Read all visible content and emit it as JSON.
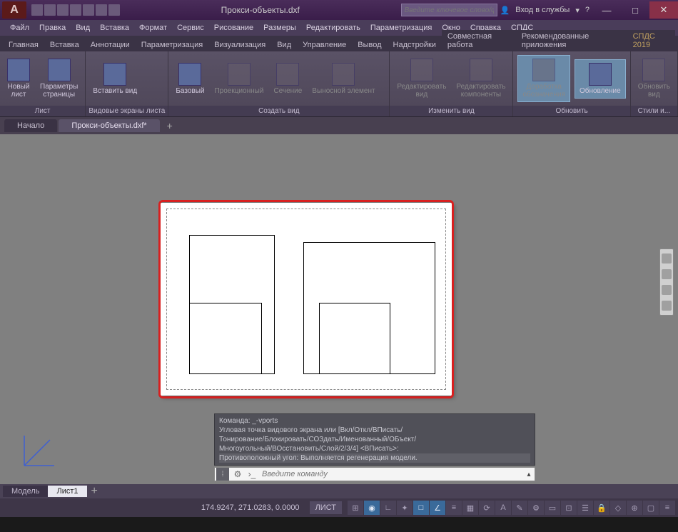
{
  "app": {
    "logo_letter": "A",
    "title": "Прокси-объекты.dxf",
    "search_placeholder": "Введите ключевое слово/фразу",
    "signin": "Вход в службы"
  },
  "window_controls": {
    "min": "—",
    "max": "□",
    "close": "✕"
  },
  "menubar": [
    "Файл",
    "Правка",
    "Вид",
    "Вставка",
    "Формат",
    "Сервис",
    "Рисование",
    "Размеры",
    "Редактировать",
    "Параметризация",
    "Окно",
    "Справка",
    "СПДС"
  ],
  "ribbon_tabs": [
    "Главная",
    "Вставка",
    "Аннотации",
    "Параметризация",
    "Визуализация",
    "Вид",
    "Управление",
    "Вывод",
    "Надстройки",
    "Совместная работа",
    "Рекомендованные приложения"
  ],
  "ribbon_extra": "СПДС 2019",
  "panels": {
    "sheet": {
      "label": "Лист",
      "buttons": [
        {
          "label": "Новый\nлист"
        },
        {
          "label": "Параметры\nстраницы"
        }
      ]
    },
    "viewports": {
      "label": "Видовые экраны листа",
      "button": {
        "label": "Вставить вид"
      }
    },
    "create": {
      "label": "Создать вид",
      "buttons": [
        {
          "label": "Базовый"
        },
        {
          "label": "Проекционный"
        },
        {
          "label": "Сечение"
        },
        {
          "label": "Выносной элемент"
        }
      ]
    },
    "edit": {
      "label": "Изменить вид",
      "buttons": [
        {
          "label": "Редактировать\nвид"
        },
        {
          "label": "Редактировать\nкомпоненты"
        }
      ]
    },
    "finalize": {
      "buttons": [
        {
          "label": "Доработка\nобозначения"
        },
        {
          "label": "Обновление"
        }
      ]
    },
    "update": {
      "label": "Обновить",
      "button": {
        "label": "Обновить\nвид"
      }
    },
    "styles": {
      "label": "Стили и..."
    }
  },
  "file_tabs": {
    "start": "Начало",
    "active": "Прокси-объекты.dxf*"
  },
  "command_history": [
    "Команда: _-vports",
    "Угловая точка видового экрана или [Вкл/Откл/ВПисать/",
    "Тонирование/Блокировать/СОЗдать/Именованный/ОБъект/",
    "Многоугольный/ВОсстановить/Слой/2/3/4] <ВПисать>:",
    "Противоположный угол: Выполняется регенерация модели."
  ],
  "command_line": {
    "placeholder": "Введите команду"
  },
  "layout_tabs": {
    "model": "Модель",
    "sheet1": "Лист1"
  },
  "statusbar": {
    "coords": "174.9247, 271.0283, 0.0000",
    "mode": "ЛИСТ"
  }
}
